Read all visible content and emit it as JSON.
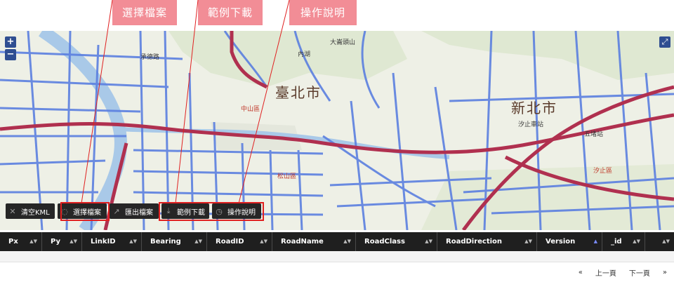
{
  "callouts": [
    "選擇檔案",
    "範例下載",
    "操作說明"
  ],
  "map": {
    "zoom_in": "+",
    "zoom_out": "−",
    "fullscreen": "⤢",
    "labels": {
      "taipei": "臺北市",
      "new_taipei": "新北市",
      "zhongshan": "中山區",
      "songshan": "松山區",
      "xizhi": "汐止區",
      "dajianshan": "大崙頭山",
      "neihu": "內湖",
      "chengde": "承德路",
      "xizhi_station": "汐止車站",
      "wuding": "五堵站"
    }
  },
  "toolbar": {
    "clear_kml": "清空KML",
    "choose_file": "選擇檔案",
    "export_file": "匯出檔案",
    "sample_download": "範例下載",
    "instructions": "操作說明"
  },
  "table": {
    "columns": [
      "Px",
      "Py",
      "LinkID",
      "Bearing",
      "RoadID",
      "RoadName",
      "RoadClass",
      "RoadDirection",
      "Version",
      "_id"
    ]
  },
  "pager": {
    "first": "«",
    "prev": "上一頁",
    "next": "下一頁",
    "last": "»"
  }
}
